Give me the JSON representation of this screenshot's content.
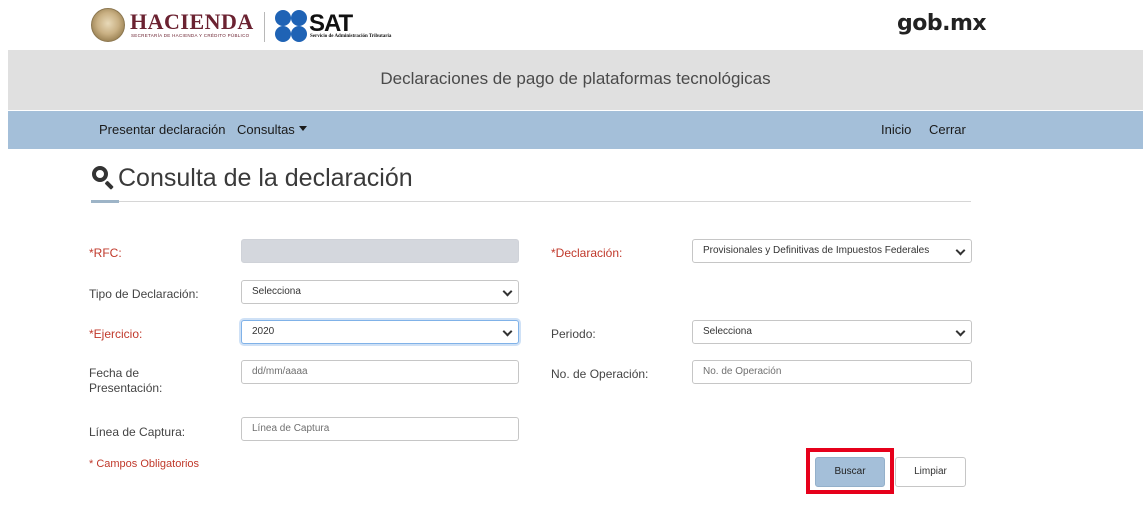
{
  "header": {
    "hacienda_logo_text": "HACIENDA",
    "hacienda_logo_subtitle": "SECRETARÍA DE HACIENDA Y CRÉDITO PÚBLICO",
    "sat_logo_text": "SAT",
    "sat_logo_subtitle": "Servicio de Administración Tributaria",
    "gob_text": "gob.mx"
  },
  "title_bar": {
    "title": "Declaraciones de pago de plataformas tecnológicas"
  },
  "nav": {
    "left_items": [
      {
        "label": "Presentar declaración"
      },
      {
        "label": "Consultas",
        "has_dropdown": true
      }
    ],
    "right_items": [
      {
        "label": "Inicio"
      },
      {
        "label": "Cerrar"
      }
    ]
  },
  "page": {
    "heading": "Consulta de la declaración",
    "heading_icon": "search-icon"
  },
  "form": {
    "rfc": {
      "label": "*RFC:",
      "value": "",
      "required": true,
      "disabled": true
    },
    "tipo_declaracion": {
      "label": "Tipo de Declaración:",
      "value": "Selecciona",
      "required": false
    },
    "ejercicio": {
      "label": "*Ejercicio:",
      "value": "2020",
      "required": true
    },
    "fecha_presentacion": {
      "label_line1": "Fecha de",
      "label_line2": "Presentación:",
      "placeholder": "dd/mm/aaaa"
    },
    "linea_captura": {
      "label": "Línea de Captura:",
      "placeholder": "Línea de Captura"
    },
    "declaracion": {
      "label": "*Declaración:",
      "value": "Provisionales y Definitivas de Impuestos Federales",
      "required": true
    },
    "periodo": {
      "label": "Periodo:",
      "value": "Selecciona",
      "required": false
    },
    "no_operacion": {
      "label": "No. de Operación:",
      "placeholder": "No. de Operación"
    },
    "required_note": "* Campos Obligatorios"
  },
  "buttons": {
    "buscar": "Buscar",
    "limpiar": "Limpiar"
  },
  "colors": {
    "navbar": "#a4bfd9",
    "title_bar": "#e0e0e0",
    "required_label": "#c0392b",
    "highlight_box": "#e6001b",
    "hacienda_brand": "#6b2231",
    "sat_brand": "#1f63b5"
  }
}
